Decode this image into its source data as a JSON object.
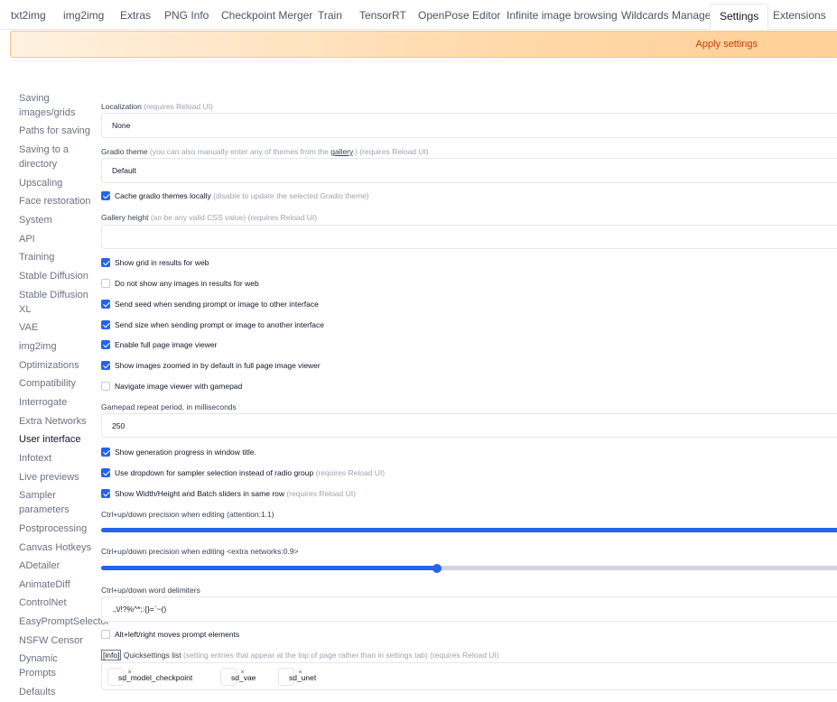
{
  "tabs": [
    "txt2img",
    "img2img",
    "Extras",
    "PNG Info",
    "Checkpoint Merger",
    "Train",
    "TensorRT",
    "OpenPose Editor",
    "Infinite image browsing",
    "Wildcards Manager",
    "Settings",
    "Extensions"
  ],
  "apply_label": "Apply settings",
  "sidebar": [
    "Saving images/grids",
    "Paths for saving",
    "Saving to a directory",
    "Upscaling",
    "Face restoration",
    "System",
    "API",
    "Training",
    "Stable Diffusion",
    "Stable Diffusion XL",
    "VAE",
    "img2img",
    "Optimizations",
    "Compatibility",
    "Interrogate",
    "Extra Networks",
    "User interface",
    "Infotext",
    "Live previews",
    "Sampler parameters",
    "Postprocessing",
    "Canvas Hotkeys",
    "ADetailer",
    "AnimateDiff",
    "ControlNet",
    "EasyPromptSelector",
    "NSFW Censor",
    "Dynamic Prompts",
    "Defaults"
  ],
  "localization": {
    "label": "Localization",
    "hint": "(requires Reload UI)",
    "value": "None"
  },
  "gradio_theme": {
    "label": "Gradio theme",
    "hint_pre": "(you can also manually enter any of themes from the",
    "link": "gallery",
    "hint_post": ".) (requires Reload UI)",
    "value": "Default"
  },
  "cache_themes": {
    "label": "Cache gradio themes locally",
    "hint": "(disable to update the selected Gradio theme)",
    "checked": true
  },
  "gallery_height": {
    "label": "Gallery height",
    "hint": "(an be any valid CSS value) (requires Reload UI)",
    "value": ""
  },
  "checks1": [
    {
      "label": "Show grid in results for web",
      "checked": true
    },
    {
      "label": "Do not show any images in results for web",
      "checked": false
    },
    {
      "label": "Send seed when sending prompt or image to other interface",
      "checked": true
    },
    {
      "label": "Send size when sending prompt or image to another interface",
      "checked": true
    },
    {
      "label": "Enable full page image viewer",
      "checked": true
    },
    {
      "label": "Show images zoomed in by default in full page image viewer",
      "checked": true
    },
    {
      "label": "Navigate image viewer with gamepad",
      "checked": false
    }
  ],
  "gamepad": {
    "label": "Gamepad repeat period, in milliseconds",
    "value": "250"
  },
  "checks2": [
    {
      "label": "Show generation progress in window title.",
      "hint": "",
      "checked": true
    },
    {
      "label": "Use dropdown for sampler selection instead of radio group",
      "hint": "(requires Reload UI)",
      "checked": true
    },
    {
      "label": "Show Width/Height and Batch sliders in same row",
      "hint": "(requires Reload UI)",
      "checked": true
    }
  ],
  "slider_attention": {
    "label": "Ctrl+up/down precision when editing (attention:1.1)",
    "fraction": 1.0
  },
  "slider_networks": {
    "label": "Ctrl+up/down precision when editing <extra networks:0.9>",
    "fraction": 0.448
  },
  "delimiters": {
    "label": "Ctrl+up/down word delimiters",
    "value": ".,\\/!?%^*;:{}=`~()"
  },
  "alt_move": {
    "label": "Alt+left/right moves prompt elements",
    "checked": false
  },
  "quicksettings": {
    "info": "[info]",
    "label": "Quicksettings list",
    "hint": "(setting entries that appear at the top of page rather than in settings tab) (requires Reload UI)",
    "items": [
      "sd_model_checkpoint",
      "sd_vae",
      "sd_unet"
    ],
    "remove_glyph": "×"
  }
}
